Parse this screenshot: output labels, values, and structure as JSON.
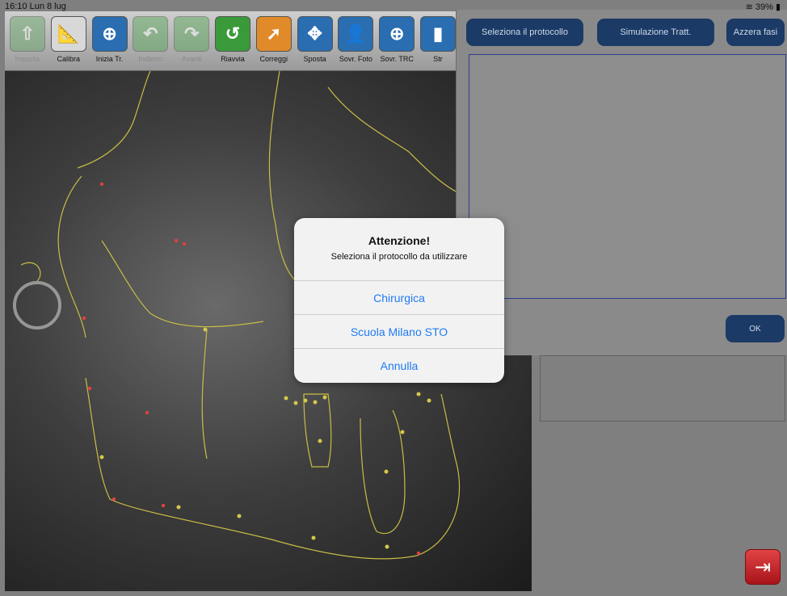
{
  "status": {
    "time": "16:10  Lun 8 lug",
    "battery": "39%"
  },
  "toolbar": [
    {
      "label": "Importa",
      "icon": "import-icon",
      "glyph": "⇧",
      "bg": "#6aa86a",
      "disabled": true
    },
    {
      "label": "Calibra",
      "icon": "ruler-icon",
      "glyph": "📐",
      "bg": "#d8d8d8",
      "disabled": false
    },
    {
      "label": "Inizia Tr.",
      "icon": "start-trace-icon",
      "glyph": "⊕",
      "bg": "#2a6db0",
      "disabled": false
    },
    {
      "label": "Indietro",
      "icon": "undo-icon",
      "glyph": "↶",
      "bg": "#5da85d",
      "disabled": true
    },
    {
      "label": "Avanti",
      "icon": "redo-icon",
      "glyph": "↷",
      "bg": "#5da85d",
      "disabled": true
    },
    {
      "label": "Riavvia",
      "icon": "restart-icon",
      "glyph": "↺",
      "bg": "#3a9a3a",
      "disabled": false
    },
    {
      "label": "Correggi",
      "icon": "correct-icon",
      "glyph": "➚",
      "bg": "#e08a2a",
      "disabled": false
    },
    {
      "label": "Sposta",
      "icon": "move-icon",
      "glyph": "✥",
      "bg": "#2a6db0",
      "disabled": false
    },
    {
      "label": "Sovr. Foto",
      "icon": "overlay-photo-icon",
      "glyph": "👤",
      "bg": "#2a6db0",
      "disabled": false
    },
    {
      "label": "Sovr. TRC",
      "icon": "overlay-trc-icon",
      "glyph": "⊕",
      "bg": "#2a6db0",
      "disabled": false
    },
    {
      "label": "Str",
      "icon": "tool-icon",
      "glyph": "▮",
      "bg": "#2a6db0",
      "disabled": false
    }
  ],
  "panel": {
    "select_protocol": "Seleziona il protocollo",
    "simulation": "Simulazione Tratt.",
    "reset_phases": "Azzera fasi",
    "ok": "OK"
  },
  "alert": {
    "title": "Attenzione!",
    "message": "Seleziona il protocollo da utilizzare",
    "options": [
      "Chirurgica",
      "Scuola Milano STO",
      "Annulla"
    ]
  },
  "colors": {
    "button_bg": "#1b3a66",
    "alert_link": "#1e7cf2",
    "trace": "#d4c84a"
  }
}
